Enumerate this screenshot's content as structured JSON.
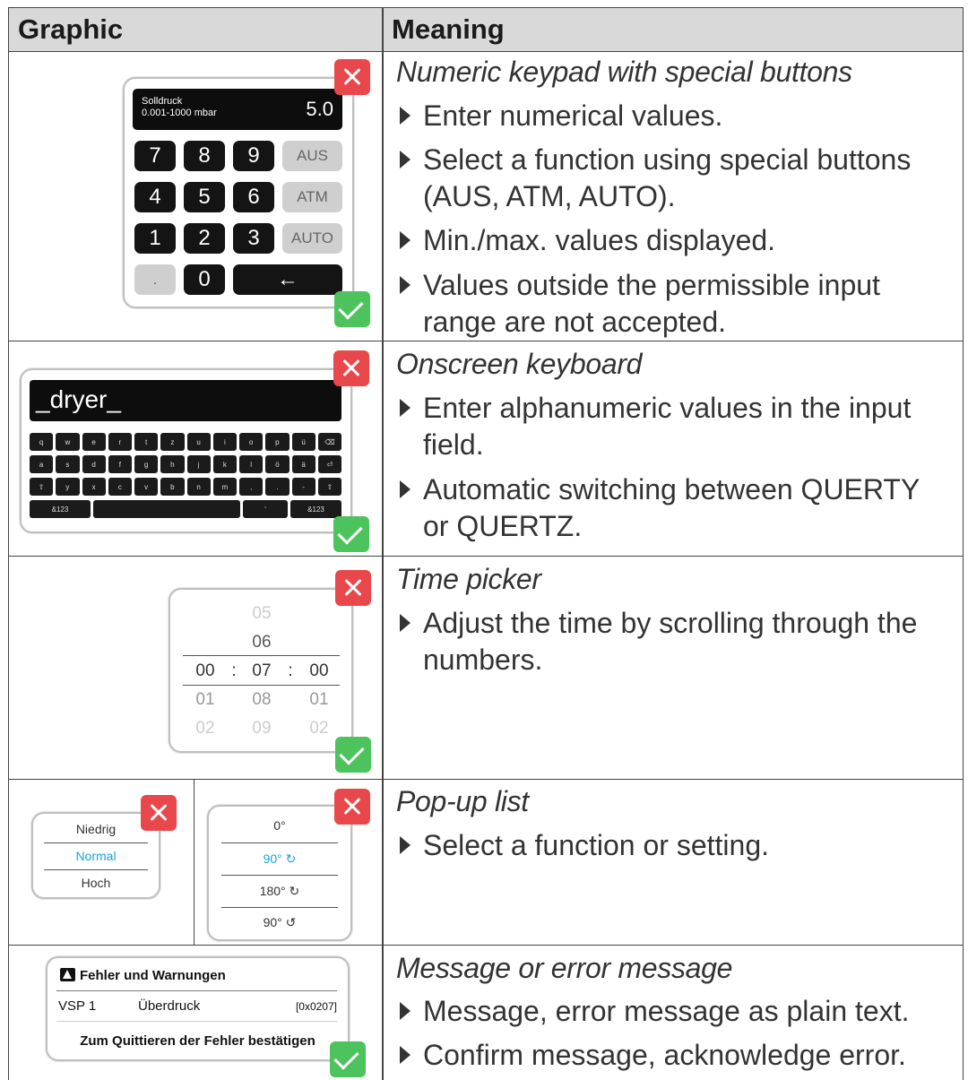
{
  "header": {
    "graphic": "Graphic",
    "meaning": "Meaning"
  },
  "rows": [
    {
      "title": "Numeric keypad with special buttons",
      "bullets": [
        "Enter numerical values.",
        "Select a function using special buttons (AUS, ATM, AUTO).",
        "Min./max. values displayed.",
        "Values outside the permissible input range are not accepted."
      ]
    },
    {
      "title": "Onscreen keyboard",
      "bullets": [
        "Enter alphanumeric values in the input field.",
        "Automatic switching between QUERTY or QUERTZ."
      ]
    },
    {
      "title": "Time picker",
      "bullets": [
        "Adjust the time by scrolling through the numbers."
      ]
    },
    {
      "title": "Pop-up list",
      "bullets": [
        "Select a function or setting."
      ]
    },
    {
      "title": "Message or error message",
      "bullets": [
        "Message, error message as plain text.",
        "Confirm message, acknowledge error."
      ]
    }
  ],
  "keypad": {
    "label": "Solldruck",
    "range": "0.001-1000 mbar",
    "value": "5.0",
    "keys": [
      "7",
      "8",
      "9",
      "AUS",
      "4",
      "5",
      "6",
      "ATM",
      "1",
      "2",
      "3",
      "AUTO",
      ".",
      "0",
      "←"
    ]
  },
  "keyboard": {
    "input_text": "_dryer_",
    "row1": [
      "q",
      "w",
      "e",
      "r",
      "t",
      "z",
      "u",
      "i",
      "o",
      "p",
      "ü",
      "⌫"
    ],
    "row2": [
      "a",
      "s",
      "d",
      "f",
      "g",
      "h",
      "j",
      "k",
      "l",
      "ö",
      "ä",
      "⏎"
    ],
    "row3": [
      "⇧",
      "y",
      "x",
      "c",
      "v",
      "b",
      "n",
      "m",
      ",",
      ".",
      "-",
      "⇧"
    ],
    "row4": [
      "&123",
      "",
      "'",
      "&123"
    ]
  },
  "time_picker": {
    "h": [
      "",
      "00",
      "01",
      "02"
    ],
    "m": [
      "05",
      "06",
      "07",
      "08",
      "09"
    ],
    "s": [
      "",
      "00",
      "01",
      "02"
    ],
    "sep": ":"
  },
  "popup_a": {
    "items": [
      "Niedrig",
      "Normal",
      "Hoch"
    ],
    "selected_color": "#1aa3d8"
  },
  "popup_b": {
    "items": [
      "0°",
      "90° ↻",
      "180° ↻",
      "90° ↺"
    ]
  },
  "message": {
    "title": "Fehler und Warnungen",
    "device": "VSP 1",
    "error": "Überdruck",
    "code": "[0x0207]",
    "confirm": "Zum Quittieren der Fehler bestätigen"
  },
  "colors": {
    "accent_red": "#e8484b",
    "accent_green": "#4cc35c"
  }
}
